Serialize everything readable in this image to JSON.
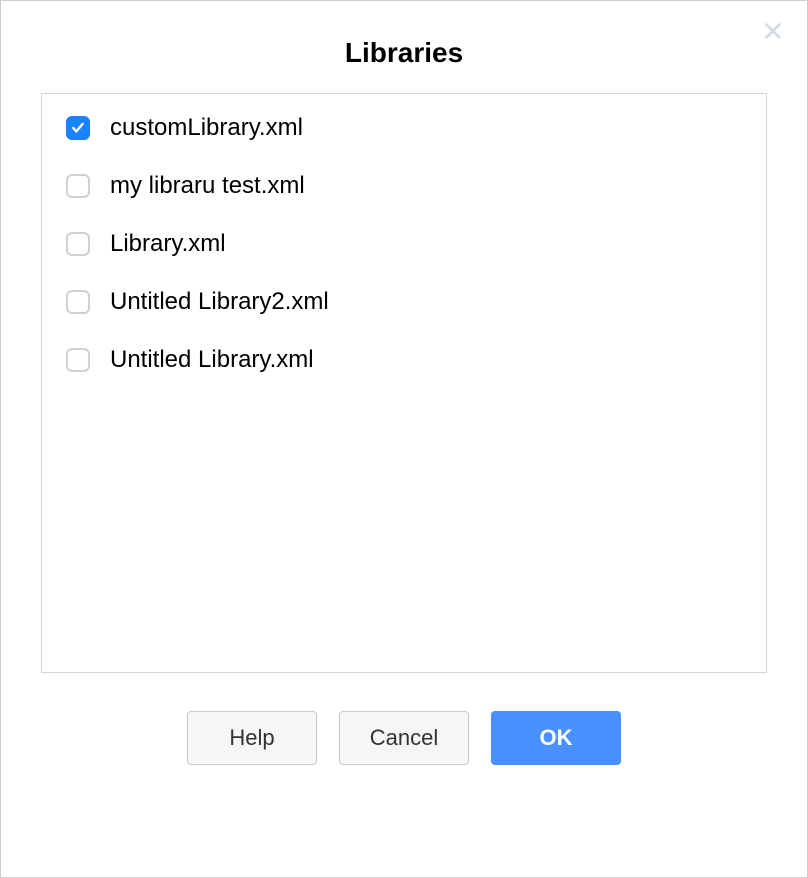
{
  "dialog": {
    "title": "Libraries",
    "items": [
      {
        "label": "customLibrary.xml",
        "checked": true
      },
      {
        "label": "my libraru test.xml",
        "checked": false
      },
      {
        "label": "Library.xml",
        "checked": false
      },
      {
        "label": "Untitled Library2.xml",
        "checked": false
      },
      {
        "label": "Untitled Library.xml",
        "checked": false
      }
    ],
    "buttons": {
      "help": "Help",
      "cancel": "Cancel",
      "ok": "OK"
    }
  }
}
